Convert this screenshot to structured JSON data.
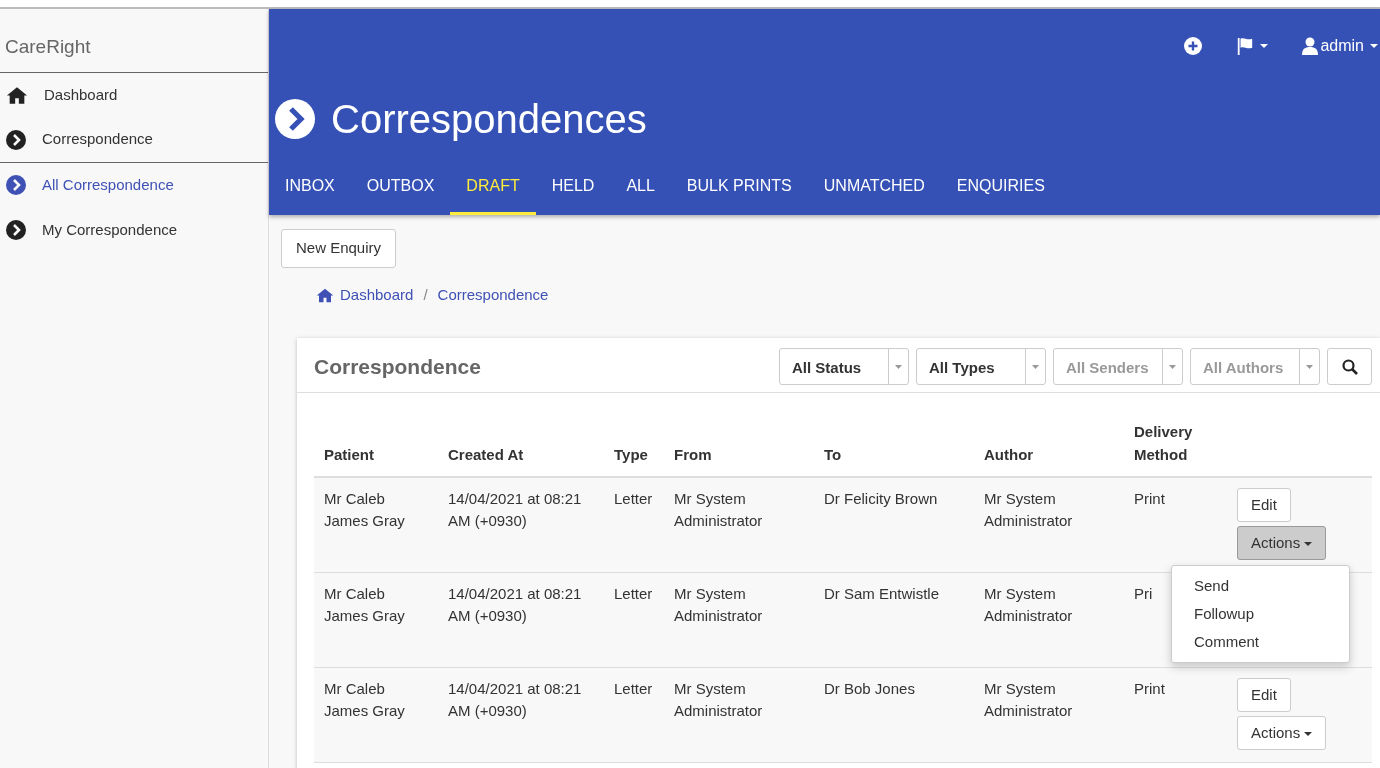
{
  "sidebar": {
    "brand": "CareRight",
    "items": [
      {
        "label": "Dashboard",
        "kind": "home",
        "selected": false,
        "section_end": false
      },
      {
        "label": "Correspondence",
        "kind": "link",
        "selected": false,
        "section_end": true
      },
      {
        "label": "All Correspondence",
        "kind": "link",
        "selected": true,
        "section_end": false
      },
      {
        "label": "My Correspondence",
        "kind": "link",
        "selected": false,
        "section_end": false
      }
    ]
  },
  "topbar": {
    "user": "admin"
  },
  "header": {
    "title": "Correspondences"
  },
  "tabs": [
    {
      "label": "INBOX",
      "selected": false
    },
    {
      "label": "OUTBOX",
      "selected": false
    },
    {
      "label": "DRAFT",
      "selected": true
    },
    {
      "label": "HELD",
      "selected": false
    },
    {
      "label": "ALL",
      "selected": false
    },
    {
      "label": "BULK PRINTS",
      "selected": false
    },
    {
      "label": "UNMATCHED",
      "selected": false
    },
    {
      "label": "ENQUIRIES",
      "selected": false
    }
  ],
  "new_button": "New Enquiry",
  "breadcrumb": [
    "Dashboard",
    "Correspondence"
  ],
  "breadcrumb_separator": "/",
  "panel": {
    "title": "Correspondence",
    "filters": [
      {
        "label": "All Status",
        "disabled": false
      },
      {
        "label": "All Types",
        "disabled": false
      },
      {
        "label": "All Senders",
        "disabled": true
      },
      {
        "label": "All Authors",
        "disabled": true
      }
    ]
  },
  "table": {
    "columns": [
      "Patient",
      "Created At",
      "Type",
      "From",
      "To",
      "Author",
      "Delivery Method"
    ],
    "rows": [
      {
        "cells": [
          "Mr Caleb James Gray",
          "14/04/2021 at 08:21 AM (+0930)",
          "Letter",
          "Mr System Administrator",
          "Dr Felicity Brown",
          "Mr System Administrator",
          "Print"
        ],
        "buttons": {
          "edit": "Edit",
          "actions": "Actions"
        },
        "menu_open": true,
        "menu": [
          "Send",
          "Followup",
          "Comment"
        ]
      },
      {
        "cells": [
          "Mr Caleb James Gray",
          "14/04/2021 at 08:21 AM (+0930)",
          "Letter",
          "Mr System Administrator",
          "Dr Sam Entwistle",
          "Mr System Administrator",
          "Pri"
        ]
      },
      {
        "cells": [
          "Mr Caleb James Gray",
          "14/04/2021 at 08:21 AM (+0930)",
          "Letter",
          "Mr System Administrator",
          "Dr Bob Jones",
          "Mr System Administrator",
          "Print"
        ],
        "buttons": {
          "edit": "Edit",
          "actions": "Actions"
        }
      }
    ]
  }
}
